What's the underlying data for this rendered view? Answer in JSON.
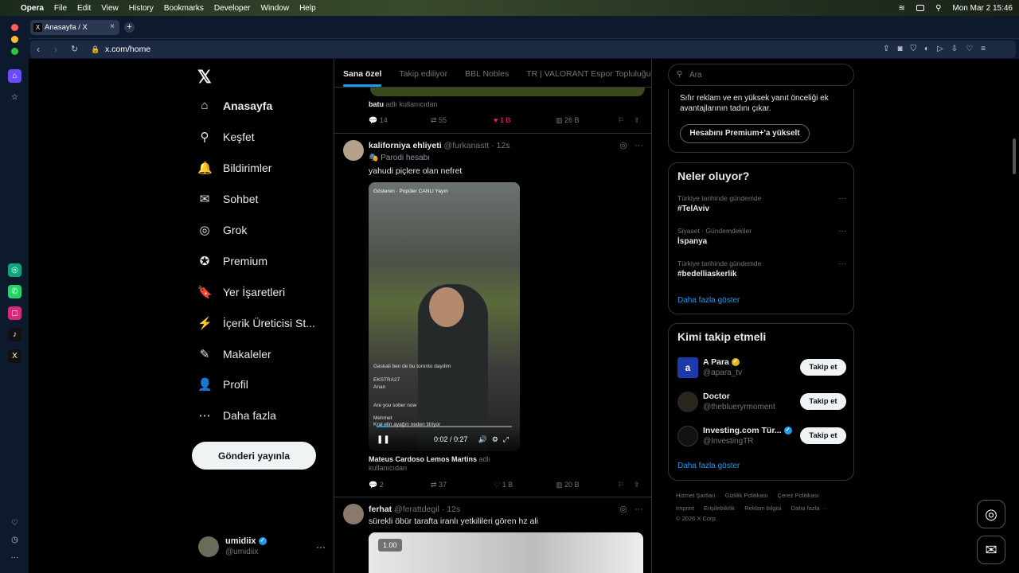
{
  "menubar": {
    "apple": "",
    "app": "Opera",
    "items": [
      "File",
      "Edit",
      "View",
      "History",
      "Bookmarks",
      "Developer",
      "Window",
      "Help"
    ],
    "clock": "Mon Mar 2  15:46"
  },
  "browser": {
    "tab_title": "Anasayfa / X",
    "tab_favicon": "X",
    "new_tab": "+",
    "url": "x.com/home",
    "tab_close": "×"
  },
  "nav": {
    "logo": "𝕏",
    "items": [
      {
        "icon": "⌂",
        "label": "Anasayfa"
      },
      {
        "icon": "⚲",
        "label": "Keşfet"
      },
      {
        "icon": "🔔",
        "label": "Bildirimler"
      },
      {
        "icon": "✉",
        "label": "Sohbet"
      },
      {
        "icon": "◎",
        "label": "Grok"
      },
      {
        "icon": "✪",
        "label": "Premium"
      },
      {
        "icon": "🔖",
        "label": "Yer İşaretleri"
      },
      {
        "icon": "⚡",
        "label": "İçerik Üreticisi St..."
      },
      {
        "icon": "✎",
        "label": "Makaleler"
      },
      {
        "icon": "👤",
        "label": "Profil"
      },
      {
        "icon": "⋯",
        "label": "Daha fazla"
      }
    ],
    "post_button": "Gönderi yayınla",
    "account": {
      "name": "umidiix",
      "handle": "@umidiix",
      "more": "···"
    }
  },
  "feed": {
    "tabs": [
      "Sana özel",
      "Takip ediliyor",
      "BBL Nobles",
      "TR | VALORANT Espor Topluluğu"
    ],
    "prev_repost_user": "batu",
    "prev_repost_suffix": "adlı kullanıcıdan",
    "prev_actions": {
      "reply": "14",
      "repost": "55",
      "like": "1 B",
      "views": "26 B"
    },
    "tweet1": {
      "name": "kaliforniya ehliyeti",
      "handle": "@furkanastt",
      "time": "· 12s",
      "badge": "🎭 Parodi hesabı",
      "text": "yahudi piçlere olan nefret",
      "video_time": "0:02 / 0:27",
      "video_top": "Gösteren  ·  Popüler CANLI Yayın",
      "chat": [
        "Gaskali ben de bu toronto daydim",
        "EKSTRA27",
        "Anan",
        "Are you sober now",
        "Mehmet",
        "Kral elin ayağın neden titriyor"
      ],
      "repost_user": "Mateus Cardoso Lemos Martins",
      "repost_suffix": "adlı kullanıcıdan",
      "actions": {
        "reply": "2",
        "repost": "37",
        "like": "1 B",
        "views": "20 B"
      }
    },
    "tweet2": {
      "name": "ferhat",
      "handle": "@ferattdegil",
      "time": "· 12s",
      "text": "sürekli öbür tarafta iranlı yetkilileri gören hz ali",
      "speed": "1.00"
    }
  },
  "sidebar": {
    "search_placeholder": "Ara",
    "premium_text": "Sıfır reklam ve en yüksek yanıt önceliği ek avantajlarının tadını çıkar.",
    "premium_button": "Hesabını Premium+'a yükselt",
    "trends_title": "Neler oluyor?",
    "trends": [
      {
        "context": "Türkiye tarihinde gündemde",
        "name": "#TelAviv"
      },
      {
        "context": "Siyaset · Gündemdekiler",
        "name": "İspanya"
      },
      {
        "context": "Türkiye tarihinde gündemde",
        "name": "#bedelliaskerlik"
      }
    ],
    "show_more": "Daha fazla göster",
    "follow_title": "Kimi takip etmeli",
    "follows": [
      {
        "name": "A Para",
        "handle": "@apara_tv",
        "button": "Takip et"
      },
      {
        "name": "Doctor",
        "handle": "@theblueryrmoment",
        "button": "Takip et"
      },
      {
        "name": "Investing.com Tür...",
        "handle": "@InvestingTR",
        "button": "Takip et"
      }
    ],
    "footer_line1": [
      "Hizmet Şartları",
      "Gizlilik Politikası",
      "Çerez Politikası"
    ],
    "footer_line2": [
      "Imprint",
      "Erişilebilirlik",
      "Reklam bilgisi",
      "Daha fazla ···"
    ],
    "copyright": "© 2026 X Corp."
  },
  "colors": {
    "accent": "#1d9bf0",
    "like": "#f91880",
    "bg": "#000000",
    "border": "#2f3336"
  }
}
